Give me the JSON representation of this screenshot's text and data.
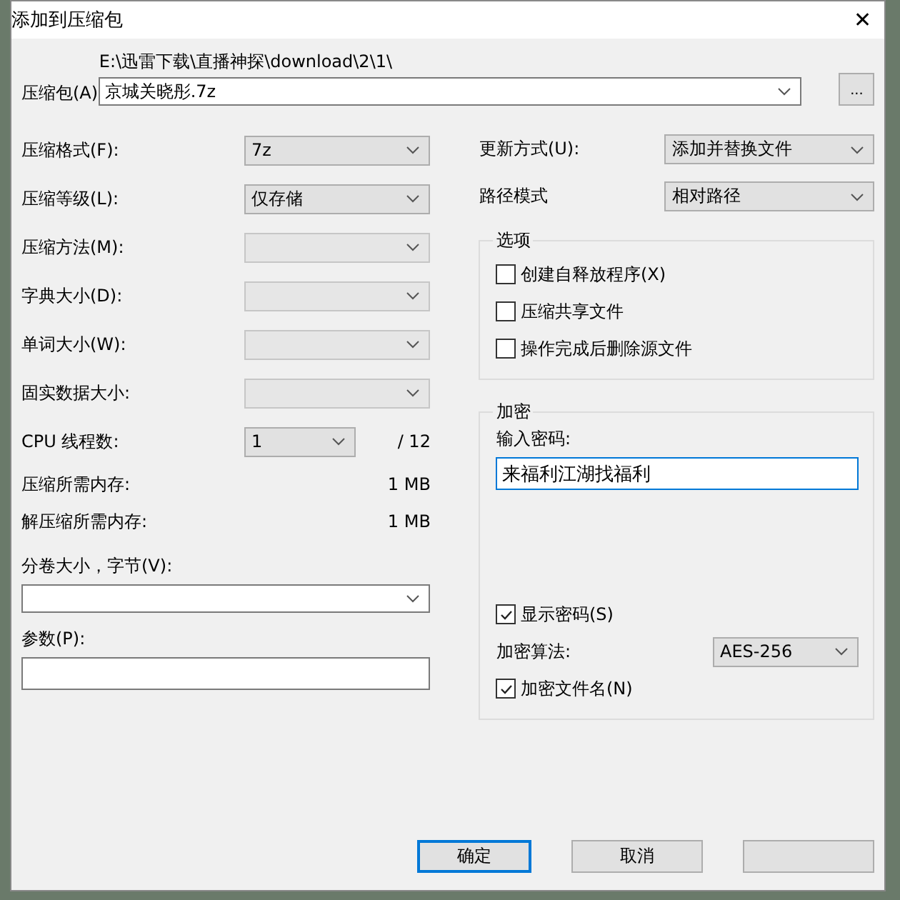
{
  "window": {
    "title": "添加到压缩包",
    "close": "✕"
  },
  "archive": {
    "label": "压缩包(A)",
    "path": "E:\\迅雷下载\\直播神探\\download\\2\\1\\",
    "value": "京城关晓彤.7z",
    "browse": "..."
  },
  "left_fields": [
    {
      "kind": "select",
      "label": "压缩格式(F):",
      "value": "7z",
      "disabled": false
    },
    {
      "kind": "select",
      "label": "压缩等级(L):",
      "value": "仅存储",
      "disabled": false
    },
    {
      "kind": "select",
      "label": "压缩方法(M):",
      "disabled": true
    },
    {
      "kind": "select",
      "label": "字典大小(D):",
      "disabled": true
    },
    {
      "kind": "select",
      "label": "单词大小(W):",
      "disabled": true
    },
    {
      "kind": "select",
      "label": "固实数据大小:",
      "disabled": true
    },
    {
      "kind": "threads",
      "label": "CPU 线程数:",
      "value": "1",
      "max": "/ 12",
      "disabled": false
    },
    {
      "kind": "info",
      "label": "压缩所需内存:",
      "value": "1 MB"
    },
    {
      "kind": "info",
      "label": "解压缩所需内存:",
      "value": "1 MB"
    }
  ],
  "volume": {
    "label": "分卷大小，字节(V):"
  },
  "params": {
    "label": "参数(P):"
  },
  "update": {
    "label": "更新方式(U):",
    "value": "添加并替换文件"
  },
  "path_mode": {
    "label": "路径模式",
    "value": "相对路径"
  },
  "options": {
    "title": "选项",
    "items": [
      {
        "label": "创建自释放程序(X)",
        "checked": false
      },
      {
        "label": "压缩共享文件",
        "checked": false
      },
      {
        "label": "操作完成后删除源文件",
        "checked": false
      }
    ]
  },
  "encryption": {
    "title": "加密",
    "password_label": "输入密码:",
    "password": "来福利江湖找福利",
    "show_password": {
      "label": "显示密码(S)",
      "checked": true
    },
    "method_label": "加密算法:",
    "method": "AES-256",
    "encrypt_names": {
      "label": "加密文件名(N)",
      "checked": true
    }
  },
  "buttons": [
    {
      "label": "确定",
      "selected": true
    },
    {
      "label": "取消",
      "selected": false
    },
    {
      "selected": false
    }
  ]
}
